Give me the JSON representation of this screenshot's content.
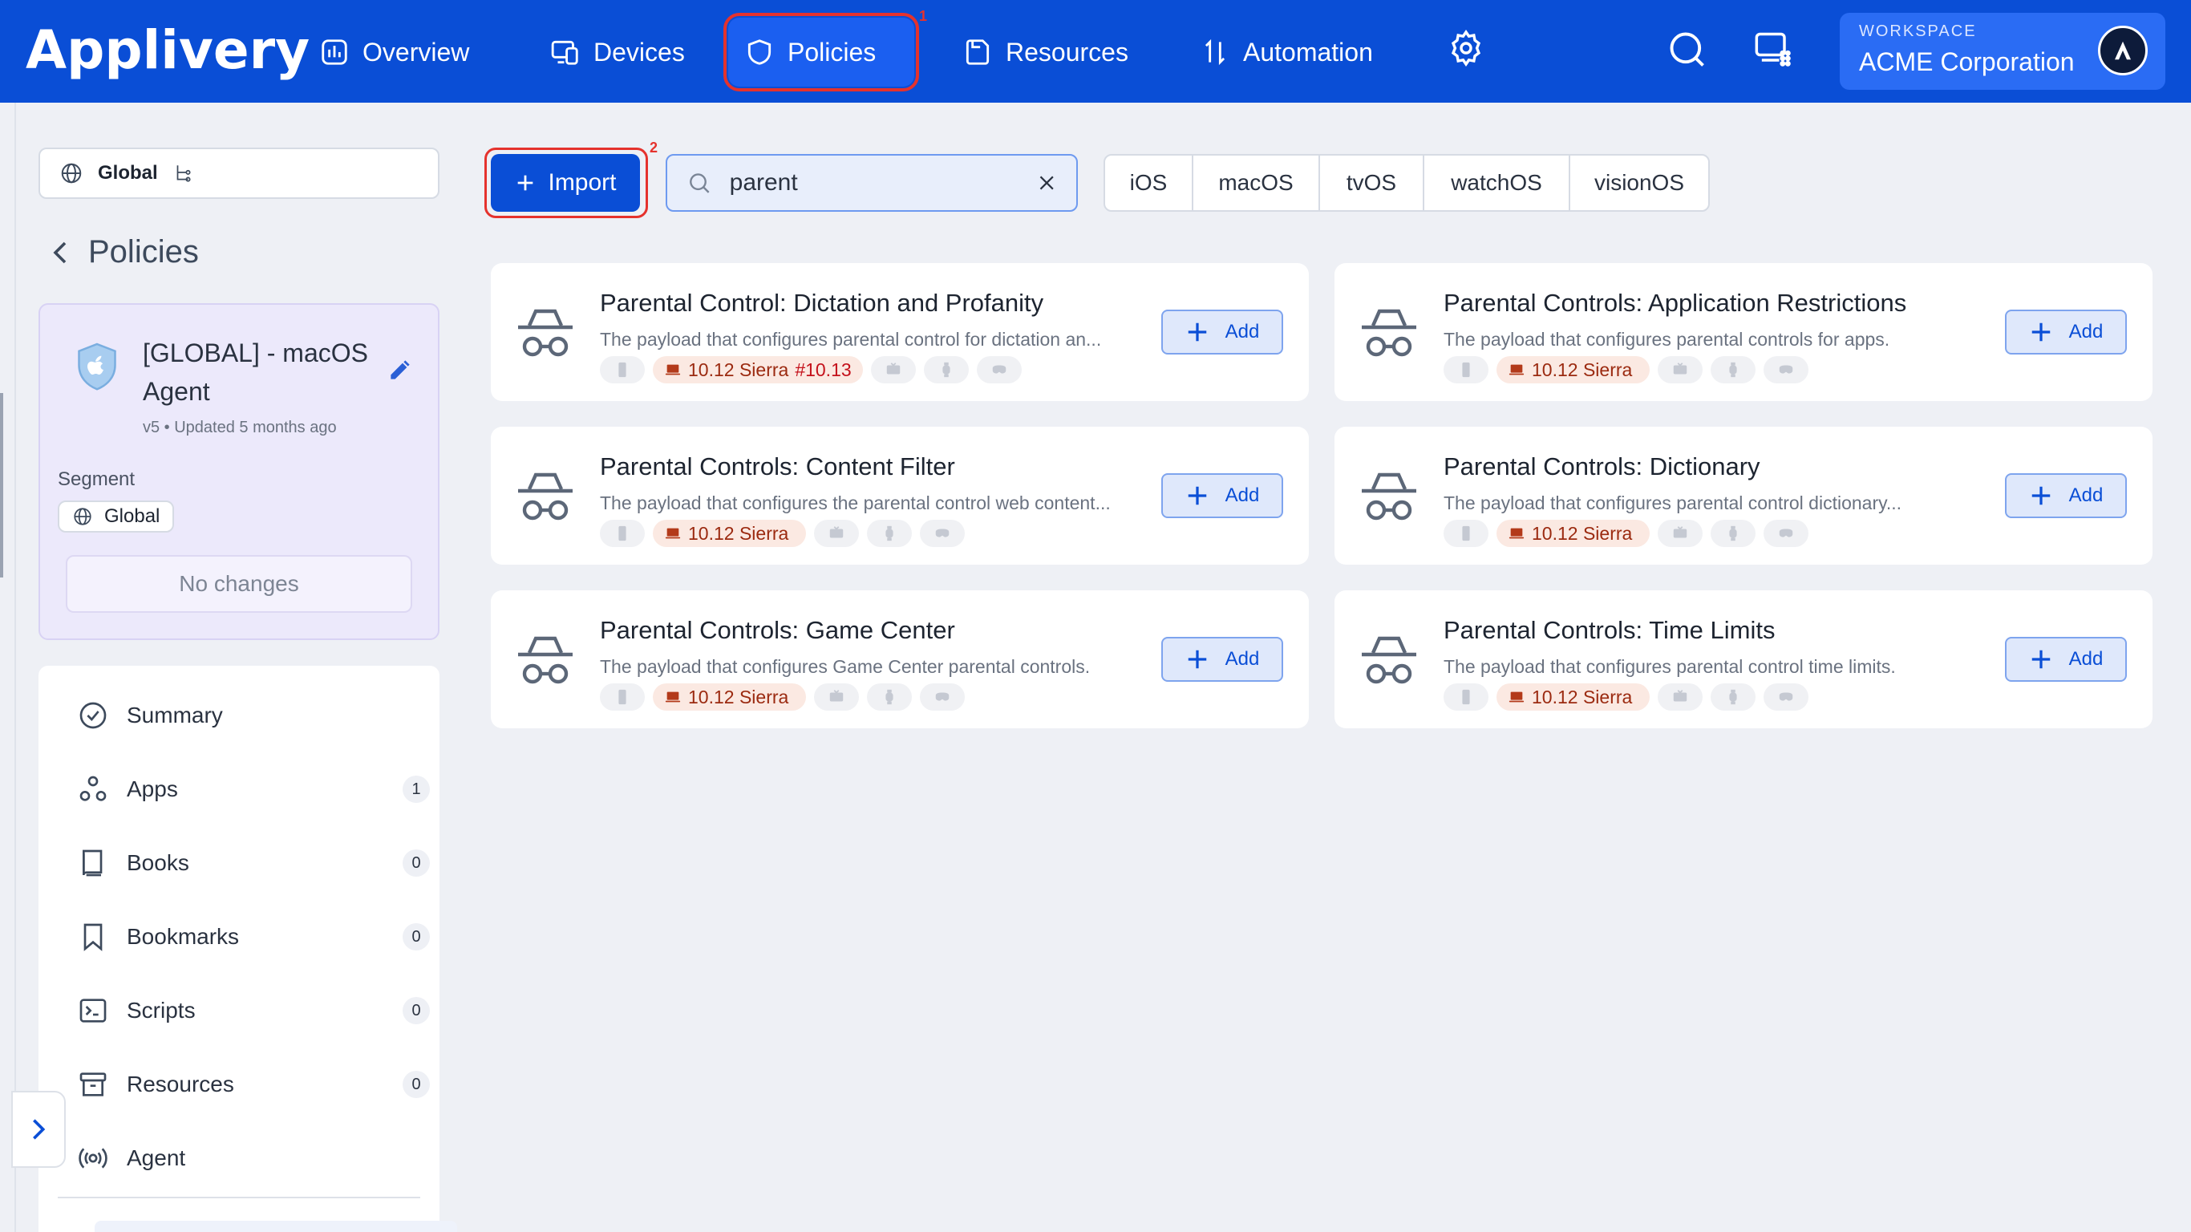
{
  "app": {
    "logo": "Applivery"
  },
  "nav": {
    "overview": "Overview",
    "devices": "Devices",
    "policies": "Policies",
    "resources": "Resources",
    "automation": "Automation",
    "marker_1": "1",
    "marker_2": "2"
  },
  "workspace": {
    "label": "WORKSPACE",
    "name": "ACME Corporation"
  },
  "sidebar": {
    "scope": "Global",
    "back_title": "Policies",
    "policy": {
      "title": "[GLOBAL] - macOS Agent",
      "meta": "v5 • Updated 5 months ago",
      "segment_label": "Segment",
      "segment_value": "Global",
      "no_changes": "No changes"
    },
    "menu": [
      {
        "label": "Summary",
        "count": ""
      },
      {
        "label": "Apps",
        "count": "1"
      },
      {
        "label": "Books",
        "count": "0"
      },
      {
        "label": "Bookmarks",
        "count": "0"
      },
      {
        "label": "Scripts",
        "count": "0"
      },
      {
        "label": "Resources",
        "count": "0"
      },
      {
        "label": "Agent",
        "count": ""
      }
    ]
  },
  "toolbar": {
    "import_label": "Import",
    "search_value": "parent",
    "os_filters": [
      "iOS",
      "macOS",
      "tvOS",
      "watchOS",
      "visionOS"
    ]
  },
  "results": [
    {
      "name": "Parental Control: Dictation and Profanity",
      "desc": "The payload that configures parental control for dictation an...",
      "mac": "10.12 Sierra",
      "mac_extra": "#10.13",
      "add": "Add"
    },
    {
      "name": "Parental Controls: Application Restrictions",
      "desc": "The payload that configures parental controls for apps.",
      "mac": "10.12 Sierra",
      "mac_extra": "",
      "add": "Add"
    },
    {
      "name": "Parental Controls: Content Filter",
      "desc": "The payload that configures the parental control web content...",
      "mac": "10.12 Sierra",
      "mac_extra": "",
      "add": "Add"
    },
    {
      "name": "Parental Controls: Dictionary",
      "desc": "The payload that configures parental control dictionary...",
      "mac": "10.12 Sierra",
      "mac_extra": "",
      "add": "Add"
    },
    {
      "name": "Parental Controls: Game Center",
      "desc": "The payload that configures Game Center parental controls.",
      "mac": "10.12 Sierra",
      "mac_extra": "",
      "add": "Add"
    },
    {
      "name": "Parental Controls: Time Limits",
      "desc": "The payload that configures parental control time limits.",
      "mac": "10.12 Sierra",
      "mac_extra": "",
      "add": "Add"
    }
  ],
  "colors": {
    "brand": "#0a4ed6",
    "highlight": "#e5322d",
    "mac_tag_bg": "#fbe9e2"
  },
  "icons": [
    "overview-icon",
    "devices-icon",
    "shield-icon",
    "resources-icon",
    "automation-icon",
    "gear-icon",
    "search-icon",
    "grid-icon",
    "globe-icon",
    "edit-icon",
    "incognito-icon",
    "plus-icon",
    "close-icon"
  ]
}
